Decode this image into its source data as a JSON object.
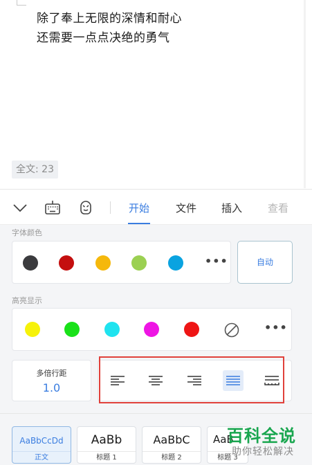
{
  "document": {
    "lines": [
      "除了奉上无限的深情和耐心",
      "还需要一点点决绝的勇气"
    ],
    "word_count": "全文: 23"
  },
  "toolbar": {
    "icons": [
      "chevron-down-icon",
      "keyboard-icon",
      "emoji-icon"
    ],
    "tabs": [
      {
        "label": "开始",
        "active": true
      },
      {
        "label": "文件",
        "active": false
      },
      {
        "label": "插入",
        "active": false
      },
      {
        "label": "查看",
        "active": false
      }
    ]
  },
  "panel": {
    "font_color": {
      "label": "字体颜色",
      "colors": [
        "#3b3b3e",
        "#c40f0f",
        "#f5b80c",
        "#9bd052",
        "#0aa3e0"
      ],
      "more": "•••",
      "auto_label": "自动"
    },
    "highlight": {
      "label": "高亮显示",
      "colors": [
        "#f6f20a",
        "#19e119",
        "#1fe3ef",
        "#ee15e4",
        "#ee1515"
      ],
      "none_icon": "no-color-icon",
      "more": "•••"
    },
    "line_spacing": {
      "label": "多倍行距",
      "value": "1.0"
    },
    "alignment": {
      "options": [
        "align-left",
        "align-center",
        "align-right",
        "align-justify",
        "align-distributed"
      ],
      "active": "align-justify"
    }
  },
  "styles": [
    {
      "sample": "AaBbCcDd",
      "name": "正文",
      "active": true
    },
    {
      "sample": "AaBb",
      "name": "标题 1",
      "active": false
    },
    {
      "sample": "AaBbC",
      "name": "标题 2",
      "active": false
    },
    {
      "sample": "AaB",
      "name": "标题 3",
      "active": false
    }
  ],
  "watermark": {
    "title": "百科全说",
    "subtitle": "助你轻松解决"
  },
  "colors": {
    "accent": "#3a7de0",
    "highlight_border": "#e0403a"
  }
}
